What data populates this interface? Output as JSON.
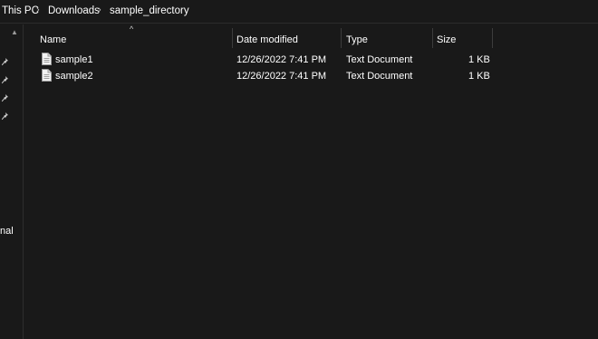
{
  "breadcrumb": {
    "items": [
      "This PC",
      "Downloads",
      "sample_directory"
    ],
    "separator": "›"
  },
  "navpane": {
    "partial_label": "nal",
    "pin_icon": "pin-icon",
    "scroll_up_icon": "chevron-up-icon"
  },
  "columns": {
    "name": "Name",
    "date_modified": "Date modified",
    "type": "Type",
    "size": "Size"
  },
  "files": [
    {
      "name": "sample1",
      "date_modified": "12/26/2022 7:41 PM",
      "type": "Text Document",
      "size": "1 KB",
      "icon": "text-document-icon"
    },
    {
      "name": "sample2",
      "date_modified": "12/26/2022 7:41 PM",
      "type": "Text Document",
      "size": "1 KB",
      "icon": "text-document-icon"
    }
  ],
  "colors": {
    "background": "#191919",
    "text": "#ffffff",
    "divider": "#3c3c3c"
  }
}
